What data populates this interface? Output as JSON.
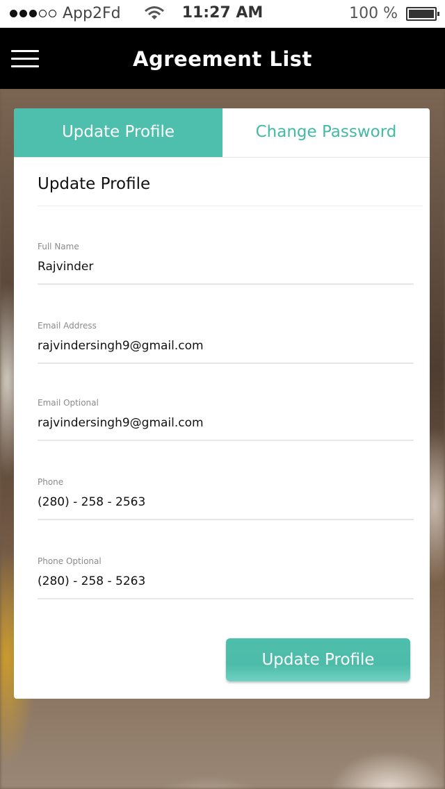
{
  "status_bar": {
    "carrier": "App2Fd",
    "time": "11:27 AM",
    "battery": "100 %"
  },
  "navbar": {
    "title": "Agreement List",
    "menu_icon": "hamburger-menu-icon"
  },
  "tabs": [
    {
      "label": "Update Profile",
      "active": true
    },
    {
      "label": "Change Password",
      "active": false
    }
  ],
  "form": {
    "section_title": "Update Profile",
    "fields": [
      {
        "label": "Full Name",
        "value": "Rajvinder"
      },
      {
        "label": "Email Address",
        "value": "rajvindersingh9@gmail.com"
      },
      {
        "label": "Email Optional",
        "value": "rajvindersingh9@gmail.com"
      },
      {
        "label": "Phone",
        "value": "(280) - 258 - 2563"
      },
      {
        "label": "Phone Optional",
        "value": "(280) - 258 - 5263"
      }
    ],
    "submit_label": "Update Profile"
  },
  "colors": {
    "accent": "#4dbfac",
    "navbar": "#000000"
  }
}
